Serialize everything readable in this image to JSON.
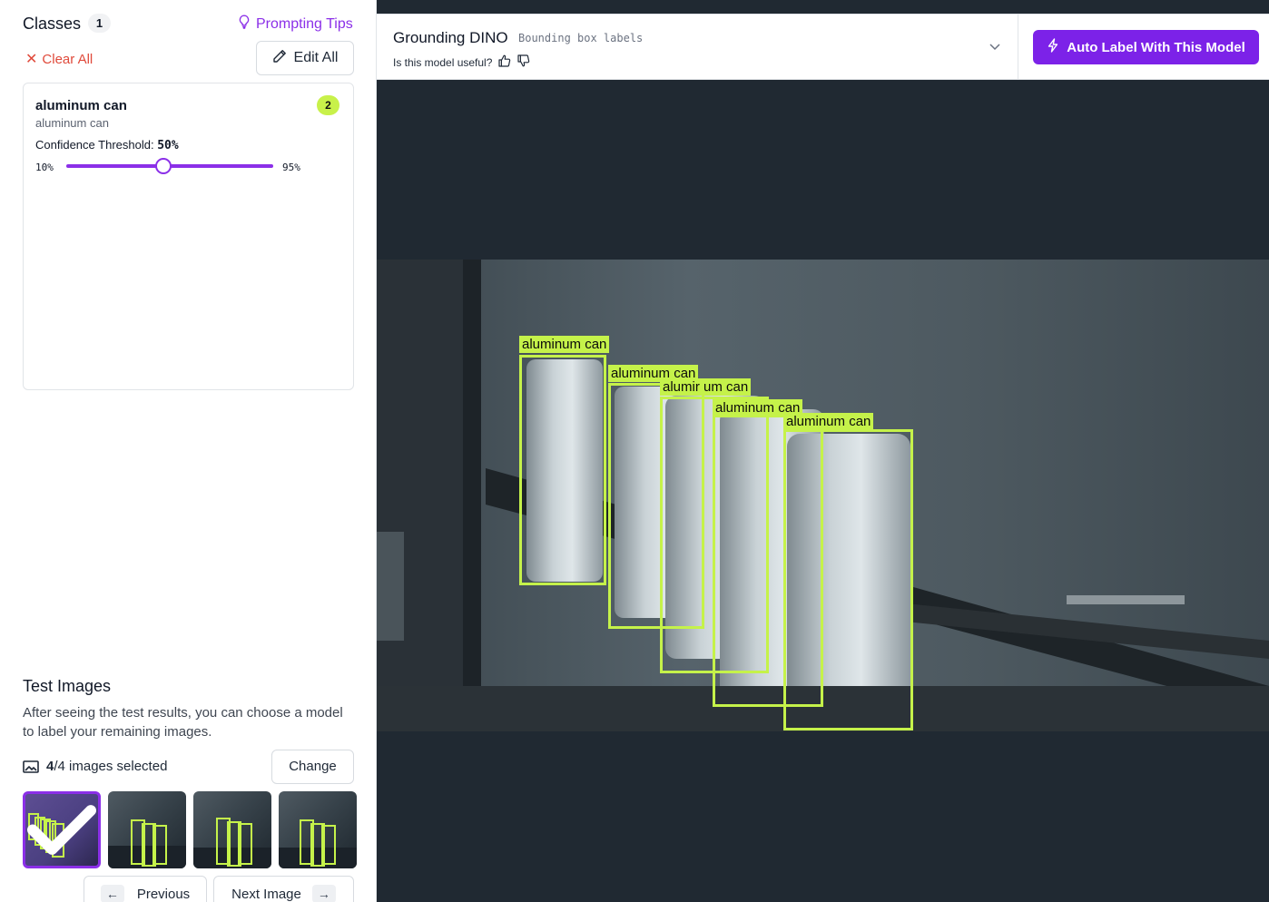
{
  "classes_panel": {
    "title": "Classes",
    "count": "1",
    "prompting_tips": "Prompting Tips",
    "clear_all": "Clear All",
    "edit_all": "Edit All"
  },
  "class_card": {
    "name": "aluminum can",
    "prompt": "aluminum can",
    "count": "2",
    "confidence_label": "Confidence Threshold:",
    "confidence_value": "50%",
    "confidence_level": 0.5,
    "min_label": "10%",
    "max_label": "95%"
  },
  "test_images": {
    "title": "Test Images",
    "description": "After seeing the test results, you can choose a model to label your remaining images.",
    "selected_count": "4",
    "selected_total": "/4 images selected",
    "change": "Change",
    "previous": "Previous",
    "next": "Next Image"
  },
  "model_header": {
    "name": "Grounding DINO",
    "type": "Bounding box labels",
    "useful_prompt": "Is this model useful?",
    "auto_label": "Auto Label With This Model"
  },
  "detections": [
    {
      "label": "aluminum can"
    },
    {
      "label": "aluminum can"
    },
    {
      "label": "alumir um can"
    },
    {
      "label": "aluminum can"
    },
    {
      "label": "aluminum can"
    }
  ],
  "colors": {
    "accent": "#7c22e8",
    "box": "#c5f24a",
    "danger": "#e04a3b",
    "viewer_bg": "#202932"
  },
  "icons": {
    "tips": "lightbulb-icon",
    "clear": "x-icon",
    "edit": "pencil-icon",
    "images": "image-icon",
    "check": "check-icon",
    "prev": "arrow-left-icon",
    "next": "arrow-right-icon",
    "thumbs_up": "thumbs-up-icon",
    "thumbs_down": "thumbs-down-icon",
    "dropdown": "chevron-down-icon",
    "auto": "lightning-icon"
  }
}
